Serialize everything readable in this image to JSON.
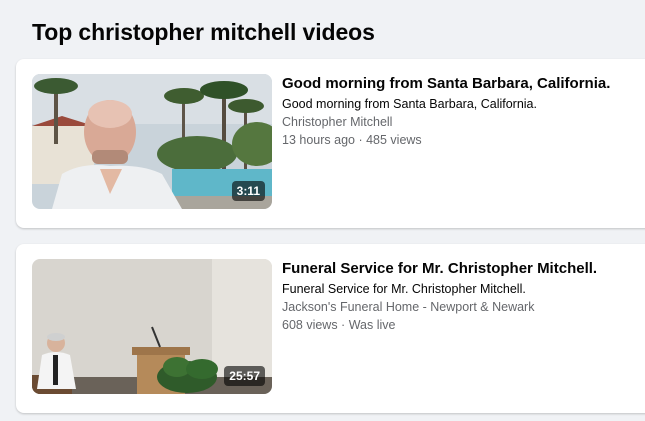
{
  "heading": "Top christopher mitchell videos",
  "videos": [
    {
      "title": "Good morning from Santa Barbara, California.",
      "description": "Good morning from Santa Barbara, California.",
      "author": "Christopher Mitchell",
      "stats": "13 hours ago · 485 views",
      "duration": "3:11"
    },
    {
      "title": "Funeral Service for Mr. Christopher Mitchell.",
      "description": "Funeral Service for Mr. Christopher Mitchell.",
      "author": "Jackson's Funeral Home - Newport & Newark",
      "stats": "608 views · Was live",
      "duration": "25:57"
    }
  ]
}
